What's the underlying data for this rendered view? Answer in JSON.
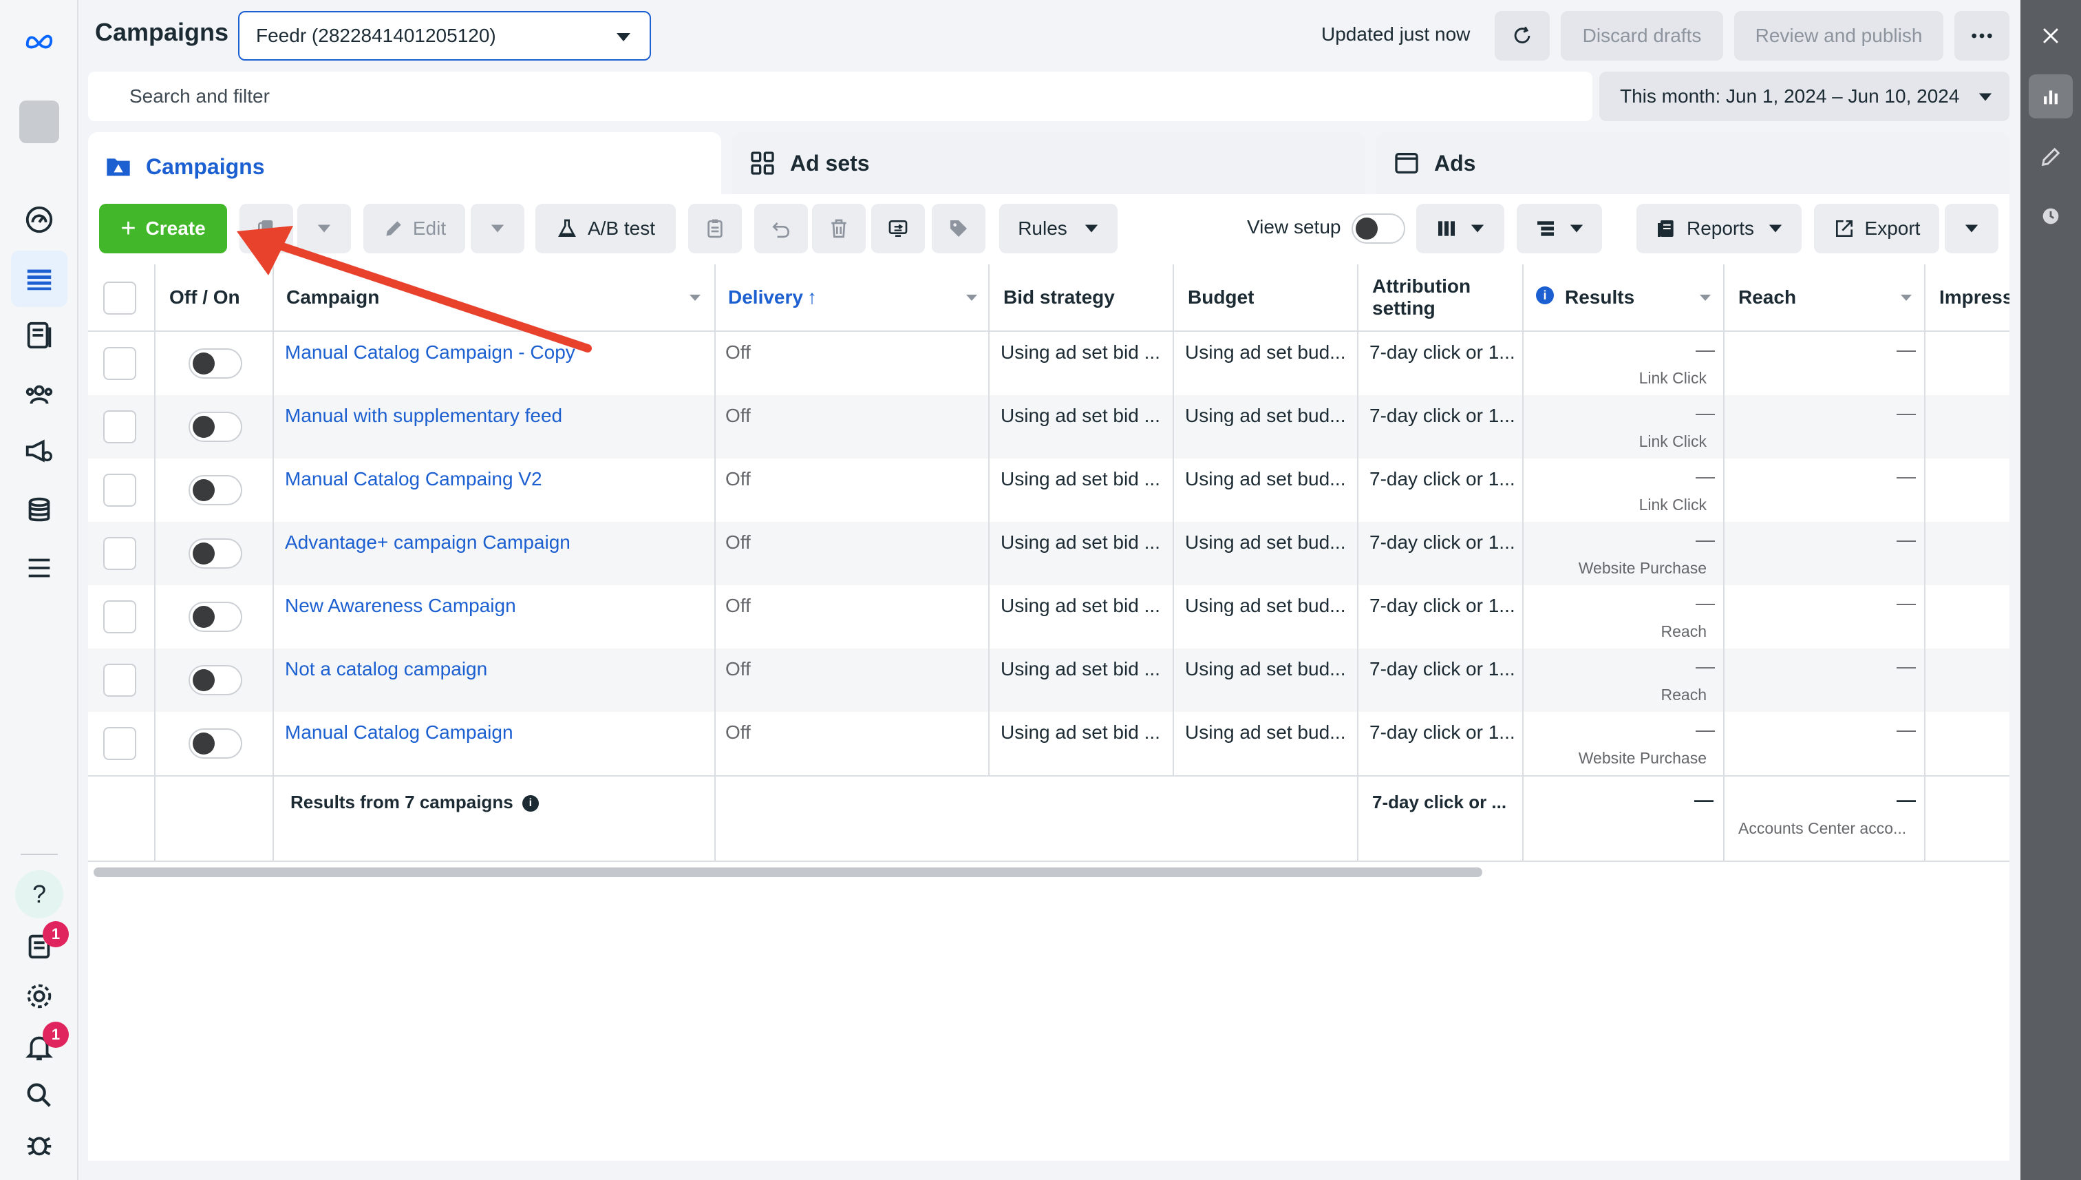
{
  "header": {
    "title": "Campaigns",
    "account_selector": "Feedr (2822841401205120)",
    "status": "Updated just now",
    "discard": "Discard drafts",
    "publish": "Review and publish"
  },
  "search": {
    "placeholder": "Search and filter"
  },
  "date_range": "This month: Jun 1, 2024 – Jun 10, 2024",
  "tabs": [
    {
      "label": "Campaigns"
    },
    {
      "label": "Ad sets"
    },
    {
      "label": "Ads"
    }
  ],
  "toolbar": {
    "create": "Create",
    "edit": "Edit",
    "ab_test": "A/B test",
    "rules": "Rules",
    "view_setup": "View setup",
    "reports": "Reports",
    "export": "Export"
  },
  "columns": {
    "off_on": "Off / On",
    "campaign": "Campaign",
    "delivery": "Delivery",
    "bid_strategy": "Bid strategy",
    "budget": "Budget",
    "attribution": "Attribution",
    "attribution2": "setting",
    "results": "Results",
    "reach": "Reach",
    "impressions": "Impress"
  },
  "rows": [
    {
      "name": "Manual Catalog Campaign - Copy",
      "delivery": "Off",
      "bid": "Using ad set bid ...",
      "budget": "Using ad set bud...",
      "attribution": "7-day click or 1...",
      "results": "—",
      "results_type": "Link Click",
      "reach": "—"
    },
    {
      "name": "Manual with supplementary feed",
      "delivery": "Off",
      "bid": "Using ad set bid ...",
      "budget": "Using ad set bud...",
      "attribution": "7-day click or 1...",
      "results": "—",
      "results_type": "Link Click",
      "reach": "—"
    },
    {
      "name": "Manual Catalog Campaing V2",
      "delivery": "Off",
      "bid": "Using ad set bid ...",
      "budget": "Using ad set bud...",
      "attribution": "7-day click or 1...",
      "results": "—",
      "results_type": "Link Click",
      "reach": "—"
    },
    {
      "name": "Advantage+ campaign Campaign",
      "delivery": "Off",
      "bid": "Using ad set bid ...",
      "budget": "Using ad set bud...",
      "attribution": "7-day click or 1...",
      "results": "—",
      "results_type": "Website Purchase",
      "reach": "—"
    },
    {
      "name": "New Awareness Campaign",
      "delivery": "Off",
      "bid": "Using ad set bid ...",
      "budget": "Using ad set bud...",
      "attribution": "7-day click or 1...",
      "results": "—",
      "results_type": "Reach",
      "reach": "—"
    },
    {
      "name": "Not a catalog campaign",
      "delivery": "Off",
      "bid": "Using ad set bid ...",
      "budget": "Using ad set bud...",
      "attribution": "7-day click or 1...",
      "results": "—",
      "results_type": "Reach",
      "reach": "—"
    },
    {
      "name": "Manual Catalog Campaign",
      "delivery": "Off",
      "bid": "Using ad set bid ...",
      "budget": "Using ad set bud...",
      "attribution": "7-day click or 1...",
      "results": "—",
      "results_type": "Website Purchase",
      "reach": "—"
    }
  ],
  "summary": {
    "label": "Results from 7 campaigns",
    "attribution": "7-day click or ...",
    "results": "—",
    "reach": "—",
    "reach_sub": "Accounts Center acco..."
  },
  "sidebar": {
    "notifications_badge": "1",
    "alerts_badge": "1"
  },
  "colors": {
    "accent": "#1b5fd1",
    "create": "#42b72a",
    "arrow": "#e8412c"
  }
}
